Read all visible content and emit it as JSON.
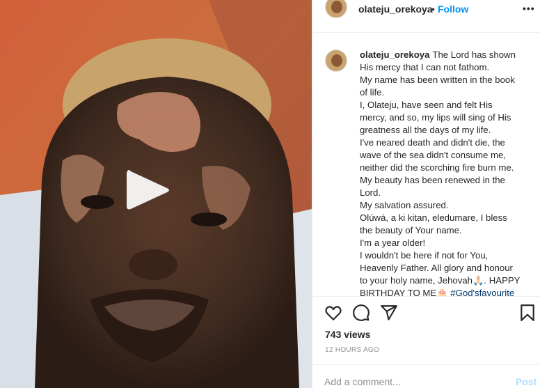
{
  "post": {
    "username": "olateju_orekoya",
    "separator": "•",
    "follow_label": "Follow",
    "more_label": "•••"
  },
  "caption": {
    "username": "olateju_orekoya",
    "lines": [
      "The Lord has shown",
      "His mercy that I can not fathom.",
      "My name has been written in the book",
      "of life.",
      "I, Olateju, have seen and felt His",
      "mercy, and so, my lips will sing of His",
      "greatness all the days of my life.",
      "I've neared death and didn't die, the",
      "wave of the sea didn't consume me,",
      "neither did the scorching fire burn me.",
      "My beauty has been renewed in the",
      "Lord.",
      "My salvation assured.",
      "Olúwá, a ki kitan, eledumare, I bless",
      "the beauty of Your name.",
      "I'm a year older!",
      "I wouldn't be here if not for You,",
      "Heavenly Father. All glory and honour",
      "to your holy name, Jehovah🙏🏻. HAPPY",
      "BIRTHDAY TO ME🎂"
    ],
    "last_hashtag": "#God'sfavourite"
  },
  "stats": {
    "views": "743 views",
    "timestamp": "12 HOURS AGO"
  },
  "comment": {
    "placeholder": "Add a comment...",
    "post_label": "Post"
  },
  "icons": {
    "play": "play-icon",
    "like": "heart-icon",
    "comment": "comment-icon",
    "share": "paper-plane-icon",
    "save": "bookmark-icon"
  },
  "colors": {
    "link": "#0095f6",
    "post_disabled": "#b2dffc",
    "muted": "#8e8e8e"
  }
}
